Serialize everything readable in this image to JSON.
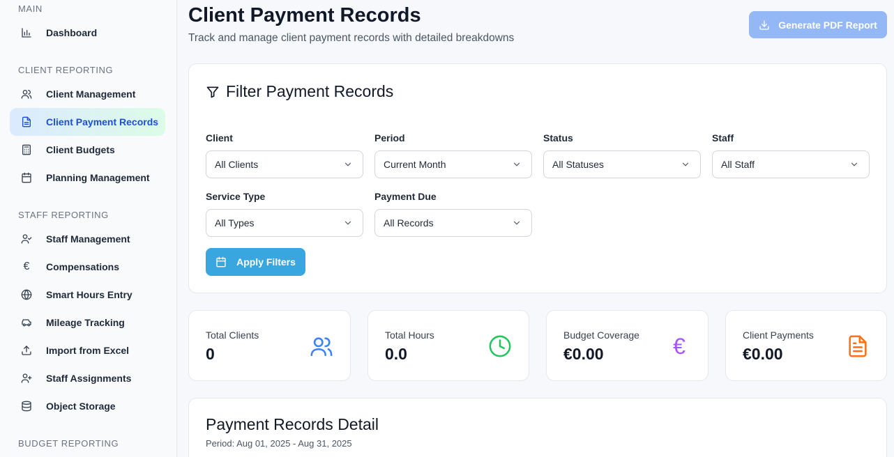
{
  "sidebar": {
    "sections": [
      {
        "title": "MAIN",
        "items": [
          {
            "label": "Dashboard",
            "icon": "bar-chart-icon"
          }
        ]
      },
      {
        "title": "CLIENT REPORTING",
        "items": [
          {
            "label": "Client Management",
            "icon": "users-icon"
          },
          {
            "label": "Client Payment Records",
            "icon": "file-text-icon"
          },
          {
            "label": "Client Budgets",
            "icon": "calculator-icon"
          },
          {
            "label": "Planning Management",
            "icon": "calendar-icon"
          }
        ]
      },
      {
        "title": "STAFF REPORTING",
        "items": [
          {
            "label": "Staff Management",
            "icon": "user-check-icon"
          },
          {
            "label": "Compensations",
            "icon": "euro-icon"
          },
          {
            "label": "Smart Hours Entry",
            "icon": "globe-icon"
          },
          {
            "label": "Mileage Tracking",
            "icon": "car-icon"
          },
          {
            "label": "Import from Excel",
            "icon": "upload-icon"
          },
          {
            "label": "Staff Assignments",
            "icon": "user-plus-icon"
          },
          {
            "label": "Object Storage",
            "icon": "database-icon"
          }
        ]
      },
      {
        "title": "BUDGET REPORTING",
        "items": []
      }
    ],
    "active_item": "Client Payment Records"
  },
  "header": {
    "title": "Client Payment Records",
    "subtitle": "Track and manage client payment records with detailed breakdowns",
    "pdf_button": "Generate PDF Report"
  },
  "filters": {
    "title": "Filter Payment Records",
    "fields": [
      {
        "label": "Client",
        "value": "All Clients"
      },
      {
        "label": "Period",
        "value": "Current Month"
      },
      {
        "label": "Status",
        "value": "All Statuses"
      },
      {
        "label": "Staff",
        "value": "All Staff"
      },
      {
        "label": "Service Type",
        "value": "All Types"
      },
      {
        "label": "Payment Due",
        "value": "All Records"
      }
    ],
    "apply_button": "Apply Filters"
  },
  "stats": [
    {
      "label": "Total Clients",
      "value": "0",
      "icon": "users-icon",
      "color": "#3b82f6"
    },
    {
      "label": "Total Hours",
      "value": "0.0",
      "icon": "clock-icon",
      "color": "#22c55e"
    },
    {
      "label": "Budget Coverage",
      "value": "€0.00",
      "icon": "euro-icon",
      "color": "#a855f7"
    },
    {
      "label": "Client Payments",
      "value": "€0.00",
      "icon": "file-text-icon",
      "color": "#f97316"
    }
  ],
  "detail": {
    "title": "Payment Records Detail",
    "period": "Period: Aug 01, 2025 - Aug 31, 2025"
  },
  "colors": {
    "active_nav_bg": "#dbeafe",
    "active_nav_text": "#1d4ed8",
    "apply_button": "#3aa6e0",
    "pdf_button": "#93b8f5"
  }
}
